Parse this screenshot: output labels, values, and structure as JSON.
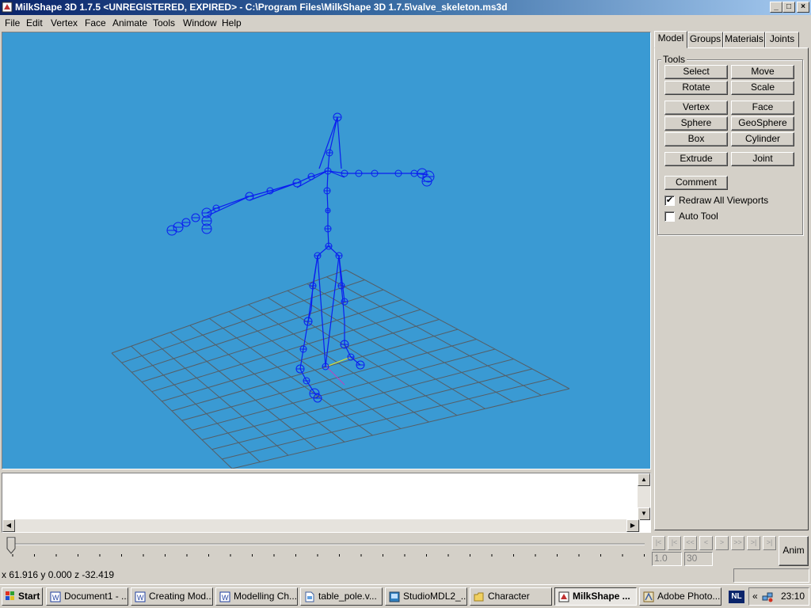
{
  "window": {
    "title": "MilkShape 3D 1.7.5 <UNREGISTERED, EXPIRED> - C:\\Program Files\\MilkShape 3D 1.7.5\\valve_skeleton.ms3d",
    "icon": "milkshape-icon"
  },
  "window_controls": {
    "minimize": "_",
    "maximize": "□",
    "close": "×"
  },
  "menu": [
    "File",
    "Edit",
    "Vertex",
    "Face",
    "Animate",
    "Tools",
    "Window",
    "Help"
  ],
  "tabs": [
    {
      "label": "Model",
      "active": true
    },
    {
      "label": "Groups",
      "active": false
    },
    {
      "label": "Materials",
      "active": false
    },
    {
      "label": "Joints",
      "active": false
    }
  ],
  "tools": {
    "group_label": "Tools",
    "buttons": [
      "Select",
      "Move",
      "Rotate",
      "Scale",
      "Vertex",
      "Face",
      "Sphere",
      "GeoSphere",
      "Box",
      "Cylinder",
      "Extrude",
      "Joint"
    ],
    "comment_label": "Comment",
    "redraw_label": "Redraw All Viewports",
    "redraw_checked": true,
    "autotool_label": "Auto Tool",
    "autotool_checked": false
  },
  "animation": {
    "frame_current": "1.0",
    "frame_total": "30",
    "anim_label": "Anim",
    "controls": [
      "|<",
      "|<",
      "<<",
      "<",
      ">",
      ">>",
      ">|",
      ">|"
    ]
  },
  "status": {
    "coords": "x 61.916 y 0.000 z -32.419"
  },
  "taskbar": {
    "start_label": "Start",
    "items": [
      {
        "label": "Document1 - ...",
        "icon": "word-icon"
      },
      {
        "label": "Creating Mod...",
        "icon": "word-icon"
      },
      {
        "label": "Modelling Ch...",
        "icon": "word-icon"
      },
      {
        "label": "table_pole.v...",
        "icon": "file-icon"
      },
      {
        "label": "StudioMDL2_...",
        "icon": "app-icon"
      },
      {
        "label": "Character",
        "icon": "folder-icon"
      },
      {
        "label": "MilkShape ...",
        "icon": "milkshape-icon",
        "active": true
      },
      {
        "label": "Adobe Photo...",
        "icon": "photoshop-icon"
      }
    ],
    "lang": "NL",
    "tray_arrow": "«",
    "clock": "23:10"
  },
  "colors": {
    "viewport": "#3a9ad3",
    "skeleton": "#0a1ef0",
    "grid": "#555e66"
  }
}
